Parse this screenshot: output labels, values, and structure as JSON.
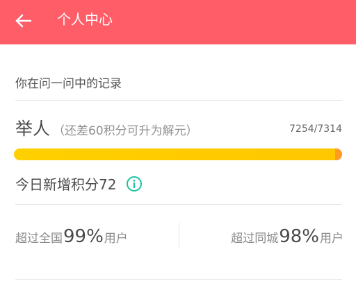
{
  "topbar": {
    "title": "个人中心",
    "color": "#ff5d68",
    "back_icon": "back-arrow-icon"
  },
  "record": {
    "header": "你在问一问中的记录",
    "level_name": "举人",
    "level_note": "（还差60积分可升为解元）",
    "progress_text": "7254/7314",
    "progress_fraction": 0.9918,
    "today_points": "今日新增积分72",
    "info_icon": "info-circle-icon",
    "info_color": "#19c3a1"
  },
  "stats": {
    "national_prefix": "超过全国",
    "national_value": "99%",
    "national_suffix": "用户",
    "city_prefix": "超过同城",
    "city_value": "98%",
    "city_suffix": "用户"
  }
}
